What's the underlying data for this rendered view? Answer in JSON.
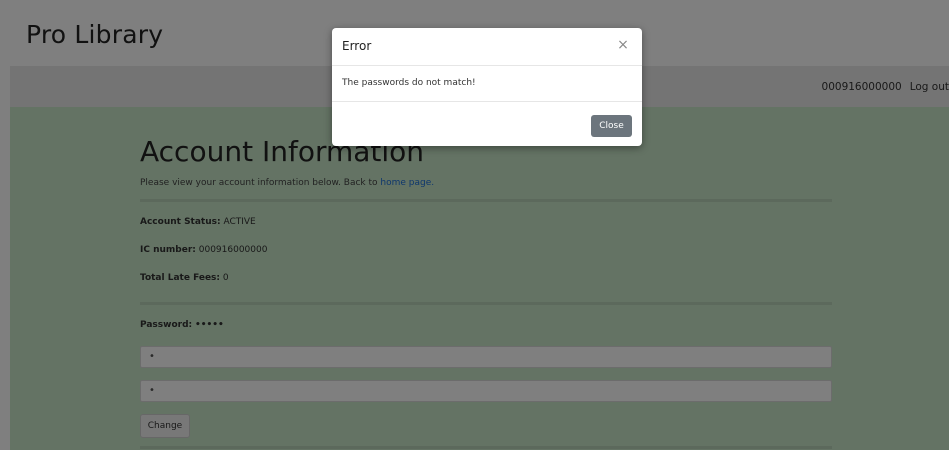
{
  "header": {
    "brand": "Pro Library"
  },
  "nav": {
    "user_ic": "000916000000",
    "logout_label": "Log out"
  },
  "account": {
    "title": "Account Information",
    "subtitle_text": "Please view your account information below. Back to",
    "home_link": "home page.",
    "status_label": "Account Status:",
    "status_value": "ACTIVE",
    "ic_label": "IC number:",
    "ic_value": "000916000000",
    "fees_label": "Total Late Fees:",
    "fees_value": "0",
    "password_label": "Password:",
    "password_value": "•••••",
    "new_password_value": "•",
    "confirm_password_value": "•",
    "change_label": "Change"
  },
  "modal": {
    "title": "Error",
    "close_symbol": "×",
    "message": "The passwords do not match!",
    "close_label": "Close"
  },
  "colors": {
    "content_bg": "#c8e6c9",
    "link": "#1e6fd9",
    "close_button": "#6c757d"
  }
}
